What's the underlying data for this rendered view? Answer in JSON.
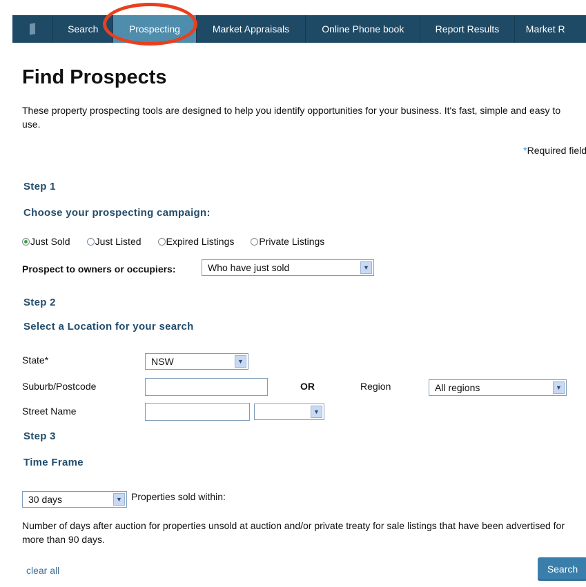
{
  "nav": {
    "items": [
      {
        "label": "Search"
      },
      {
        "label": "Prospecting"
      },
      {
        "label": "Market Appraisals"
      },
      {
        "label": "Online Phone book"
      },
      {
        "label": "Report Results"
      },
      {
        "label": "Market R"
      }
    ],
    "active": "Prospecting"
  },
  "page": {
    "title": "Find Prospects",
    "intro": "These property prospecting tools are designed to help you identify opportunities for your business. It's fast, simple and easy to use.",
    "required_star": "*",
    "required_text": "Required fields"
  },
  "step1": {
    "heading": "Step 1",
    "subheading": "Choose your prospecting campaign:",
    "radios": [
      {
        "label": "Just Sold",
        "checked": true
      },
      {
        "label": "Just Listed",
        "checked": false
      },
      {
        "label": "Expired Listings",
        "checked": false
      },
      {
        "label": "Private Listings",
        "checked": false
      }
    ],
    "prospect_label": "Prospect to owners or occupiers:",
    "prospect_value": "Who have just sold"
  },
  "step2": {
    "heading": "Step 2",
    "subheading": "Select a Location for your search",
    "state_label": "State*",
    "state_value": "NSW",
    "suburb_label": "Suburb/Postcode",
    "or_text": "OR",
    "region_label": "Region",
    "region_value": "All regions",
    "street_label": "Street Name",
    "street_type_value": ""
  },
  "step3": {
    "heading": "Step 3",
    "subheading": "Time Frame",
    "days_value": "30 days",
    "days_label": "Properties sold within:",
    "note": "Number of days after auction for properties unsold at auction and/or private treaty for sale listings that have been advertised for more than 90 days."
  },
  "actions": {
    "clear_label": "clear all",
    "search_label": "Search"
  },
  "colors": {
    "navbar": "#1f4a66",
    "nav_active": "#4f8dad",
    "highlight": "#e8401f",
    "heading": "#234d6c",
    "button": "#3a7fab"
  }
}
